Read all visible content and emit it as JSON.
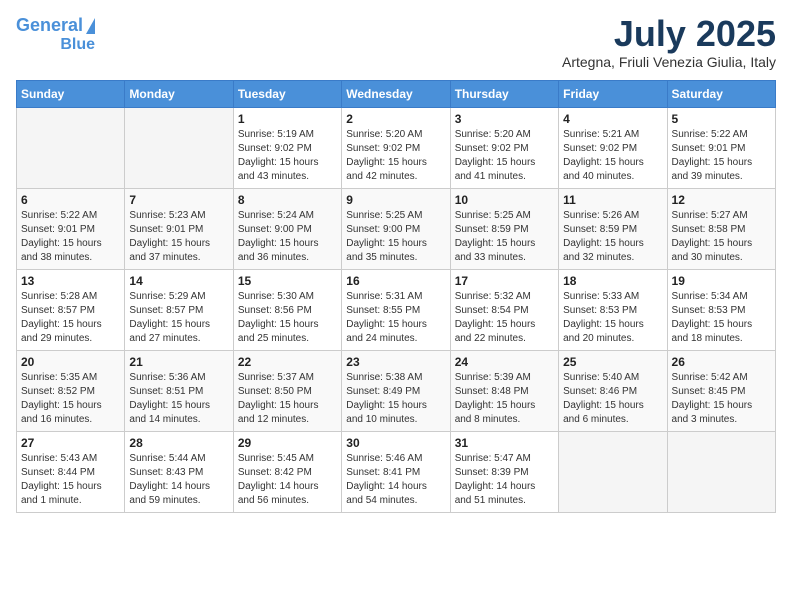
{
  "header": {
    "logo_line1": "General",
    "logo_line2": "Blue",
    "month": "July 2025",
    "location": "Artegna, Friuli Venezia Giulia, Italy"
  },
  "days_of_week": [
    "Sunday",
    "Monday",
    "Tuesday",
    "Wednesday",
    "Thursday",
    "Friday",
    "Saturday"
  ],
  "weeks": [
    [
      {
        "day": "",
        "info": ""
      },
      {
        "day": "",
        "info": ""
      },
      {
        "day": "1",
        "info": "Sunrise: 5:19 AM\nSunset: 9:02 PM\nDaylight: 15 hours and 43 minutes."
      },
      {
        "day": "2",
        "info": "Sunrise: 5:20 AM\nSunset: 9:02 PM\nDaylight: 15 hours and 42 minutes."
      },
      {
        "day": "3",
        "info": "Sunrise: 5:20 AM\nSunset: 9:02 PM\nDaylight: 15 hours and 41 minutes."
      },
      {
        "day": "4",
        "info": "Sunrise: 5:21 AM\nSunset: 9:02 PM\nDaylight: 15 hours and 40 minutes."
      },
      {
        "day": "5",
        "info": "Sunrise: 5:22 AM\nSunset: 9:01 PM\nDaylight: 15 hours and 39 minutes."
      }
    ],
    [
      {
        "day": "6",
        "info": "Sunrise: 5:22 AM\nSunset: 9:01 PM\nDaylight: 15 hours and 38 minutes."
      },
      {
        "day": "7",
        "info": "Sunrise: 5:23 AM\nSunset: 9:01 PM\nDaylight: 15 hours and 37 minutes."
      },
      {
        "day": "8",
        "info": "Sunrise: 5:24 AM\nSunset: 9:00 PM\nDaylight: 15 hours and 36 minutes."
      },
      {
        "day": "9",
        "info": "Sunrise: 5:25 AM\nSunset: 9:00 PM\nDaylight: 15 hours and 35 minutes."
      },
      {
        "day": "10",
        "info": "Sunrise: 5:25 AM\nSunset: 8:59 PM\nDaylight: 15 hours and 33 minutes."
      },
      {
        "day": "11",
        "info": "Sunrise: 5:26 AM\nSunset: 8:59 PM\nDaylight: 15 hours and 32 minutes."
      },
      {
        "day": "12",
        "info": "Sunrise: 5:27 AM\nSunset: 8:58 PM\nDaylight: 15 hours and 30 minutes."
      }
    ],
    [
      {
        "day": "13",
        "info": "Sunrise: 5:28 AM\nSunset: 8:57 PM\nDaylight: 15 hours and 29 minutes."
      },
      {
        "day": "14",
        "info": "Sunrise: 5:29 AM\nSunset: 8:57 PM\nDaylight: 15 hours and 27 minutes."
      },
      {
        "day": "15",
        "info": "Sunrise: 5:30 AM\nSunset: 8:56 PM\nDaylight: 15 hours and 25 minutes."
      },
      {
        "day": "16",
        "info": "Sunrise: 5:31 AM\nSunset: 8:55 PM\nDaylight: 15 hours and 24 minutes."
      },
      {
        "day": "17",
        "info": "Sunrise: 5:32 AM\nSunset: 8:54 PM\nDaylight: 15 hours and 22 minutes."
      },
      {
        "day": "18",
        "info": "Sunrise: 5:33 AM\nSunset: 8:53 PM\nDaylight: 15 hours and 20 minutes."
      },
      {
        "day": "19",
        "info": "Sunrise: 5:34 AM\nSunset: 8:53 PM\nDaylight: 15 hours and 18 minutes."
      }
    ],
    [
      {
        "day": "20",
        "info": "Sunrise: 5:35 AM\nSunset: 8:52 PM\nDaylight: 15 hours and 16 minutes."
      },
      {
        "day": "21",
        "info": "Sunrise: 5:36 AM\nSunset: 8:51 PM\nDaylight: 15 hours and 14 minutes."
      },
      {
        "day": "22",
        "info": "Sunrise: 5:37 AM\nSunset: 8:50 PM\nDaylight: 15 hours and 12 minutes."
      },
      {
        "day": "23",
        "info": "Sunrise: 5:38 AM\nSunset: 8:49 PM\nDaylight: 15 hours and 10 minutes."
      },
      {
        "day": "24",
        "info": "Sunrise: 5:39 AM\nSunset: 8:48 PM\nDaylight: 15 hours and 8 minutes."
      },
      {
        "day": "25",
        "info": "Sunrise: 5:40 AM\nSunset: 8:46 PM\nDaylight: 15 hours and 6 minutes."
      },
      {
        "day": "26",
        "info": "Sunrise: 5:42 AM\nSunset: 8:45 PM\nDaylight: 15 hours and 3 minutes."
      }
    ],
    [
      {
        "day": "27",
        "info": "Sunrise: 5:43 AM\nSunset: 8:44 PM\nDaylight: 15 hours and 1 minute."
      },
      {
        "day": "28",
        "info": "Sunrise: 5:44 AM\nSunset: 8:43 PM\nDaylight: 14 hours and 59 minutes."
      },
      {
        "day": "29",
        "info": "Sunrise: 5:45 AM\nSunset: 8:42 PM\nDaylight: 14 hours and 56 minutes."
      },
      {
        "day": "30",
        "info": "Sunrise: 5:46 AM\nSunset: 8:41 PM\nDaylight: 14 hours and 54 minutes."
      },
      {
        "day": "31",
        "info": "Sunrise: 5:47 AM\nSunset: 8:39 PM\nDaylight: 14 hours and 51 minutes."
      },
      {
        "day": "",
        "info": ""
      },
      {
        "day": "",
        "info": ""
      }
    ]
  ]
}
